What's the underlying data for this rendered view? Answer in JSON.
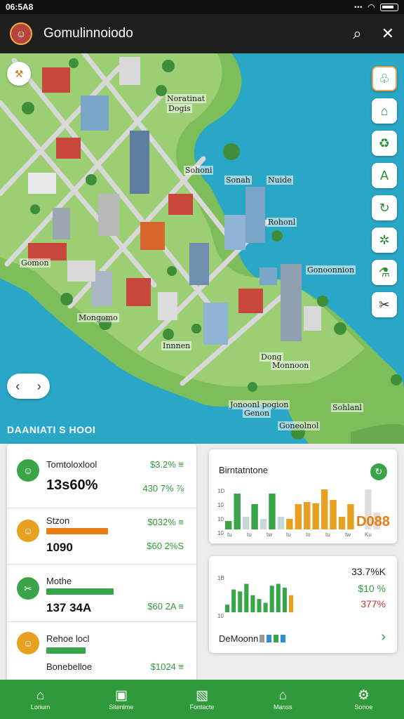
{
  "status_bar": {
    "time": "06:5A8"
  },
  "app_bar": {
    "title": "Gomulinnoiodo",
    "avatar_icon": "user-avatar-icon"
  },
  "map": {
    "labels": {
      "l1": "Noratinat",
      "l2": "Dogis",
      "l3": "Sohoni",
      "l4": "Sonah",
      "l5": "Nuide",
      "l6": "Rohonl",
      "l7": "Gomon",
      "l8": "Gonoonnion",
      "l9": "Mongomo",
      "l10": "Innnen",
      "l11": "Dong",
      "l12": "Monnoon",
      "l13": "Jonoonl pogion",
      "l14": "Genon",
      "l15": "Sohlanl",
      "l16": "Goneolnol"
    },
    "tools": [
      "leaf-icon",
      "tree-icon",
      "recycle-icon",
      "tent-icon",
      "refresh-icon",
      "gear-icon",
      "flask-icon",
      "tools-icon"
    ]
  },
  "section_title": "DAANIATI S HOOI",
  "stats": [
    {
      "name": "Tomtoloxlool",
      "value": "13s60%",
      "pct_top": "$3.2% ≡",
      "pct_bottom": "430 7% ⅞"
    },
    {
      "name": "Stzon",
      "value": "1090",
      "pct_top": "$032% ≡",
      "pct_bottom": "$60 2%S",
      "bar": 0.6,
      "bar_color": "#e87d12"
    },
    {
      "name": "Mothe",
      "value": "137 34A",
      "pct_top": "$60 2A ≡",
      "bar": 0.62,
      "bar_color": "#36a548"
    },
    {
      "name": "Rehoe locl",
      "value": "",
      "pct_top": "",
      "bar": 0.35,
      "bar_color": "#36a548"
    },
    {
      "name": "Bonebelloe",
      "value": "",
      "pct_top": "$1024 ≡"
    }
  ],
  "card1": {
    "title": "Birntatntone",
    "big_number": "D088",
    "axis_y": [
      "1D",
      "10",
      "10",
      "10"
    ],
    "x_labels": [
      "tu",
      "tu",
      "tw",
      "tu",
      "to",
      "tu",
      "tw",
      "Ku"
    ],
    "bars": [
      {
        "v": 0.2,
        "c": "#3aa548"
      },
      {
        "v": 0.85,
        "c": "#3aa548"
      },
      {
        "v": 0.3,
        "c": "#c8d8d8"
      },
      {
        "v": 0.6,
        "c": "#3aa548"
      },
      {
        "v": 0.25,
        "c": "#c8d8d8"
      },
      {
        "v": 0.85,
        "c": "#3aa548"
      },
      {
        "v": 0.3,
        "c": "#c8d8d8"
      },
      {
        "v": 0.25,
        "c": "#e8a020"
      },
      {
        "v": 0.6,
        "c": "#e8a020"
      },
      {
        "v": 0.65,
        "c": "#e8a020"
      },
      {
        "v": 0.62,
        "c": "#e8a020"
      },
      {
        "v": 0.95,
        "c": "#e8a020"
      },
      {
        "v": 0.7,
        "c": "#e8a020"
      },
      {
        "v": 0.3,
        "c": "#e8a020"
      },
      {
        "v": 0.6,
        "c": "#e8a020"
      },
      {
        "v": 0.2,
        "c": "#ffffff"
      },
      {
        "v": 0.95,
        "c": "#dedede"
      },
      {
        "v": 0.4,
        "c": "#dedede"
      }
    ]
  },
  "card2": {
    "axis_y": [
      "1B",
      "10"
    ],
    "pcts": [
      "33.7%K",
      "$10 %",
      "377%"
    ],
    "pct_colors": [
      "#222222",
      "#2e9c3d",
      "#d0302a"
    ],
    "footer": "DeMoonn",
    "legend_colors": [
      "#9a9a9a",
      "#2b8fd6",
      "#3aa548",
      "#2b8fd6"
    ],
    "bars": [
      {
        "v": 0.2,
        "c": "#3aa548"
      },
      {
        "v": 0.6,
        "c": "#3aa548"
      },
      {
        "v": 0.55,
        "c": "#3aa548"
      },
      {
        "v": 0.75,
        "c": "#3aa548"
      },
      {
        "v": 0.45,
        "c": "#3aa548"
      },
      {
        "v": 0.35,
        "c": "#3aa548"
      },
      {
        "v": 0.25,
        "c": "#3aa548"
      },
      {
        "v": 0.7,
        "c": "#3aa548"
      },
      {
        "v": 0.75,
        "c": "#3aa548"
      },
      {
        "v": 0.65,
        "c": "#3aa548"
      },
      {
        "v": 0.45,
        "c": "#e8a020"
      }
    ]
  },
  "bottom_nav": [
    {
      "label": "Lorium",
      "icon": "home-icon"
    },
    {
      "label": "Sitenlme",
      "icon": "calendar-icon"
    },
    {
      "label": "Fontacte",
      "icon": "map-icon"
    },
    {
      "label": "Manss",
      "icon": "store-icon"
    },
    {
      "label": "Sonoe",
      "icon": "settings-icon"
    }
  ]
}
